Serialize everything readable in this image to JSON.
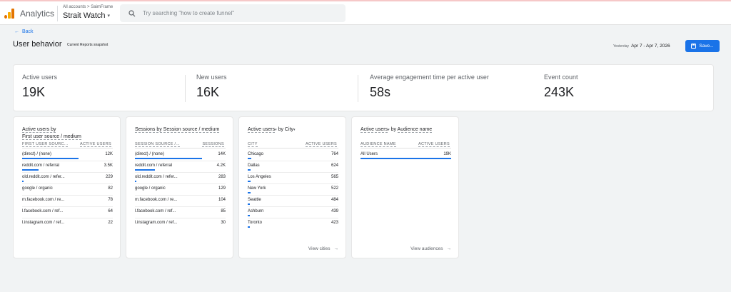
{
  "header": {
    "brand": "Analytics",
    "crumb": "All accounts > SaimFrame",
    "property": "Strait Watch",
    "search_placeholder": "Try searching \"how to create funnel\""
  },
  "toolbar": {
    "back": "Back",
    "title": "User behavior",
    "snapshot": "Current Reports snapshot",
    "date_label": "Yesterday",
    "date_range": "Apr 7 - Apr 7, 2026",
    "save": "Save..."
  },
  "kpis": [
    {
      "label": "Active users",
      "value": "19K"
    },
    {
      "label": "New users",
      "value": "16K"
    },
    {
      "label": "Average engagement time per active user",
      "value": "58s"
    },
    {
      "label": "Event count",
      "value": "243K"
    }
  ],
  "cards": [
    {
      "title_line1": "Active users by",
      "title_line2": "First user source / medium",
      "col1": "FIRST USER SOURC...",
      "col2": "ACTIVE USERS",
      "rows": [
        {
          "k": "(direct) / (none)",
          "v": "12K",
          "frac": 0.62
        },
        {
          "k": "reddit.com / referral",
          "v": "3.5K",
          "frac": 0.18
        },
        {
          "k": "old.reddit.com / refer...",
          "v": "229",
          "frac": 0.012
        },
        {
          "k": "google / organic",
          "v": "82",
          "frac": 0
        },
        {
          "k": "m.facebook.com / re...",
          "v": "78",
          "frac": 0
        },
        {
          "k": "l.facebook.com / ref...",
          "v": "64",
          "frac": 0
        },
        {
          "k": "l.instagram.com / ref...",
          "v": "22",
          "frac": 0
        }
      ]
    },
    {
      "title_line1": "Sessions by Session source / medium",
      "col1": "SESSION SOURCE /...",
      "col2": "SESSIONS",
      "rows": [
        {
          "k": "(direct) / (none)",
          "v": "14K",
          "frac": 0.74
        },
        {
          "k": "reddit.com / referral",
          "v": "4.2K",
          "frac": 0.22
        },
        {
          "k": "old.reddit.com / refer...",
          "v": "283",
          "frac": 0.015
        },
        {
          "k": "google / organic",
          "v": "129",
          "frac": 0
        },
        {
          "k": "m.facebook.com / re...",
          "v": "104",
          "frac": 0
        },
        {
          "k": "l.facebook.com / ref...",
          "v": "85",
          "frac": 0
        },
        {
          "k": "l.instagram.com / ref...",
          "v": "30",
          "frac": 0
        }
      ]
    },
    {
      "title_pre": "Active users",
      "title_mid": " by City",
      "col1": "CITY",
      "col2": "ACTIVE USERS",
      "rows": [
        {
          "k": "Chicago",
          "v": "764",
          "frac": 0.04
        },
        {
          "k": "Dallas",
          "v": "624",
          "frac": 0.033
        },
        {
          "k": "Los Angeles",
          "v": "565",
          "frac": 0.03
        },
        {
          "k": "New York",
          "v": "522",
          "frac": 0.028
        },
        {
          "k": "Seattle",
          "v": "484",
          "frac": 0.025
        },
        {
          "k": "Ashburn",
          "v": "439",
          "frac": 0.023
        },
        {
          "k": "Toronto",
          "v": "423",
          "frac": 0.022
        }
      ],
      "link": "View cities"
    },
    {
      "title_pre": "Active users",
      "title_mid": " by ",
      "title_post": "Audience name",
      "col1": "AUDIENCE NAME",
      "col2": "ACTIVE USERS",
      "rows": [
        {
          "k": "All Users",
          "v": "19K",
          "frac": 1.0
        }
      ],
      "link": "View audiences"
    }
  ],
  "colors": {
    "accent": "#1a73e8",
    "logo_orange": "#f9ab00",
    "logo_dark": "#e37400"
  }
}
